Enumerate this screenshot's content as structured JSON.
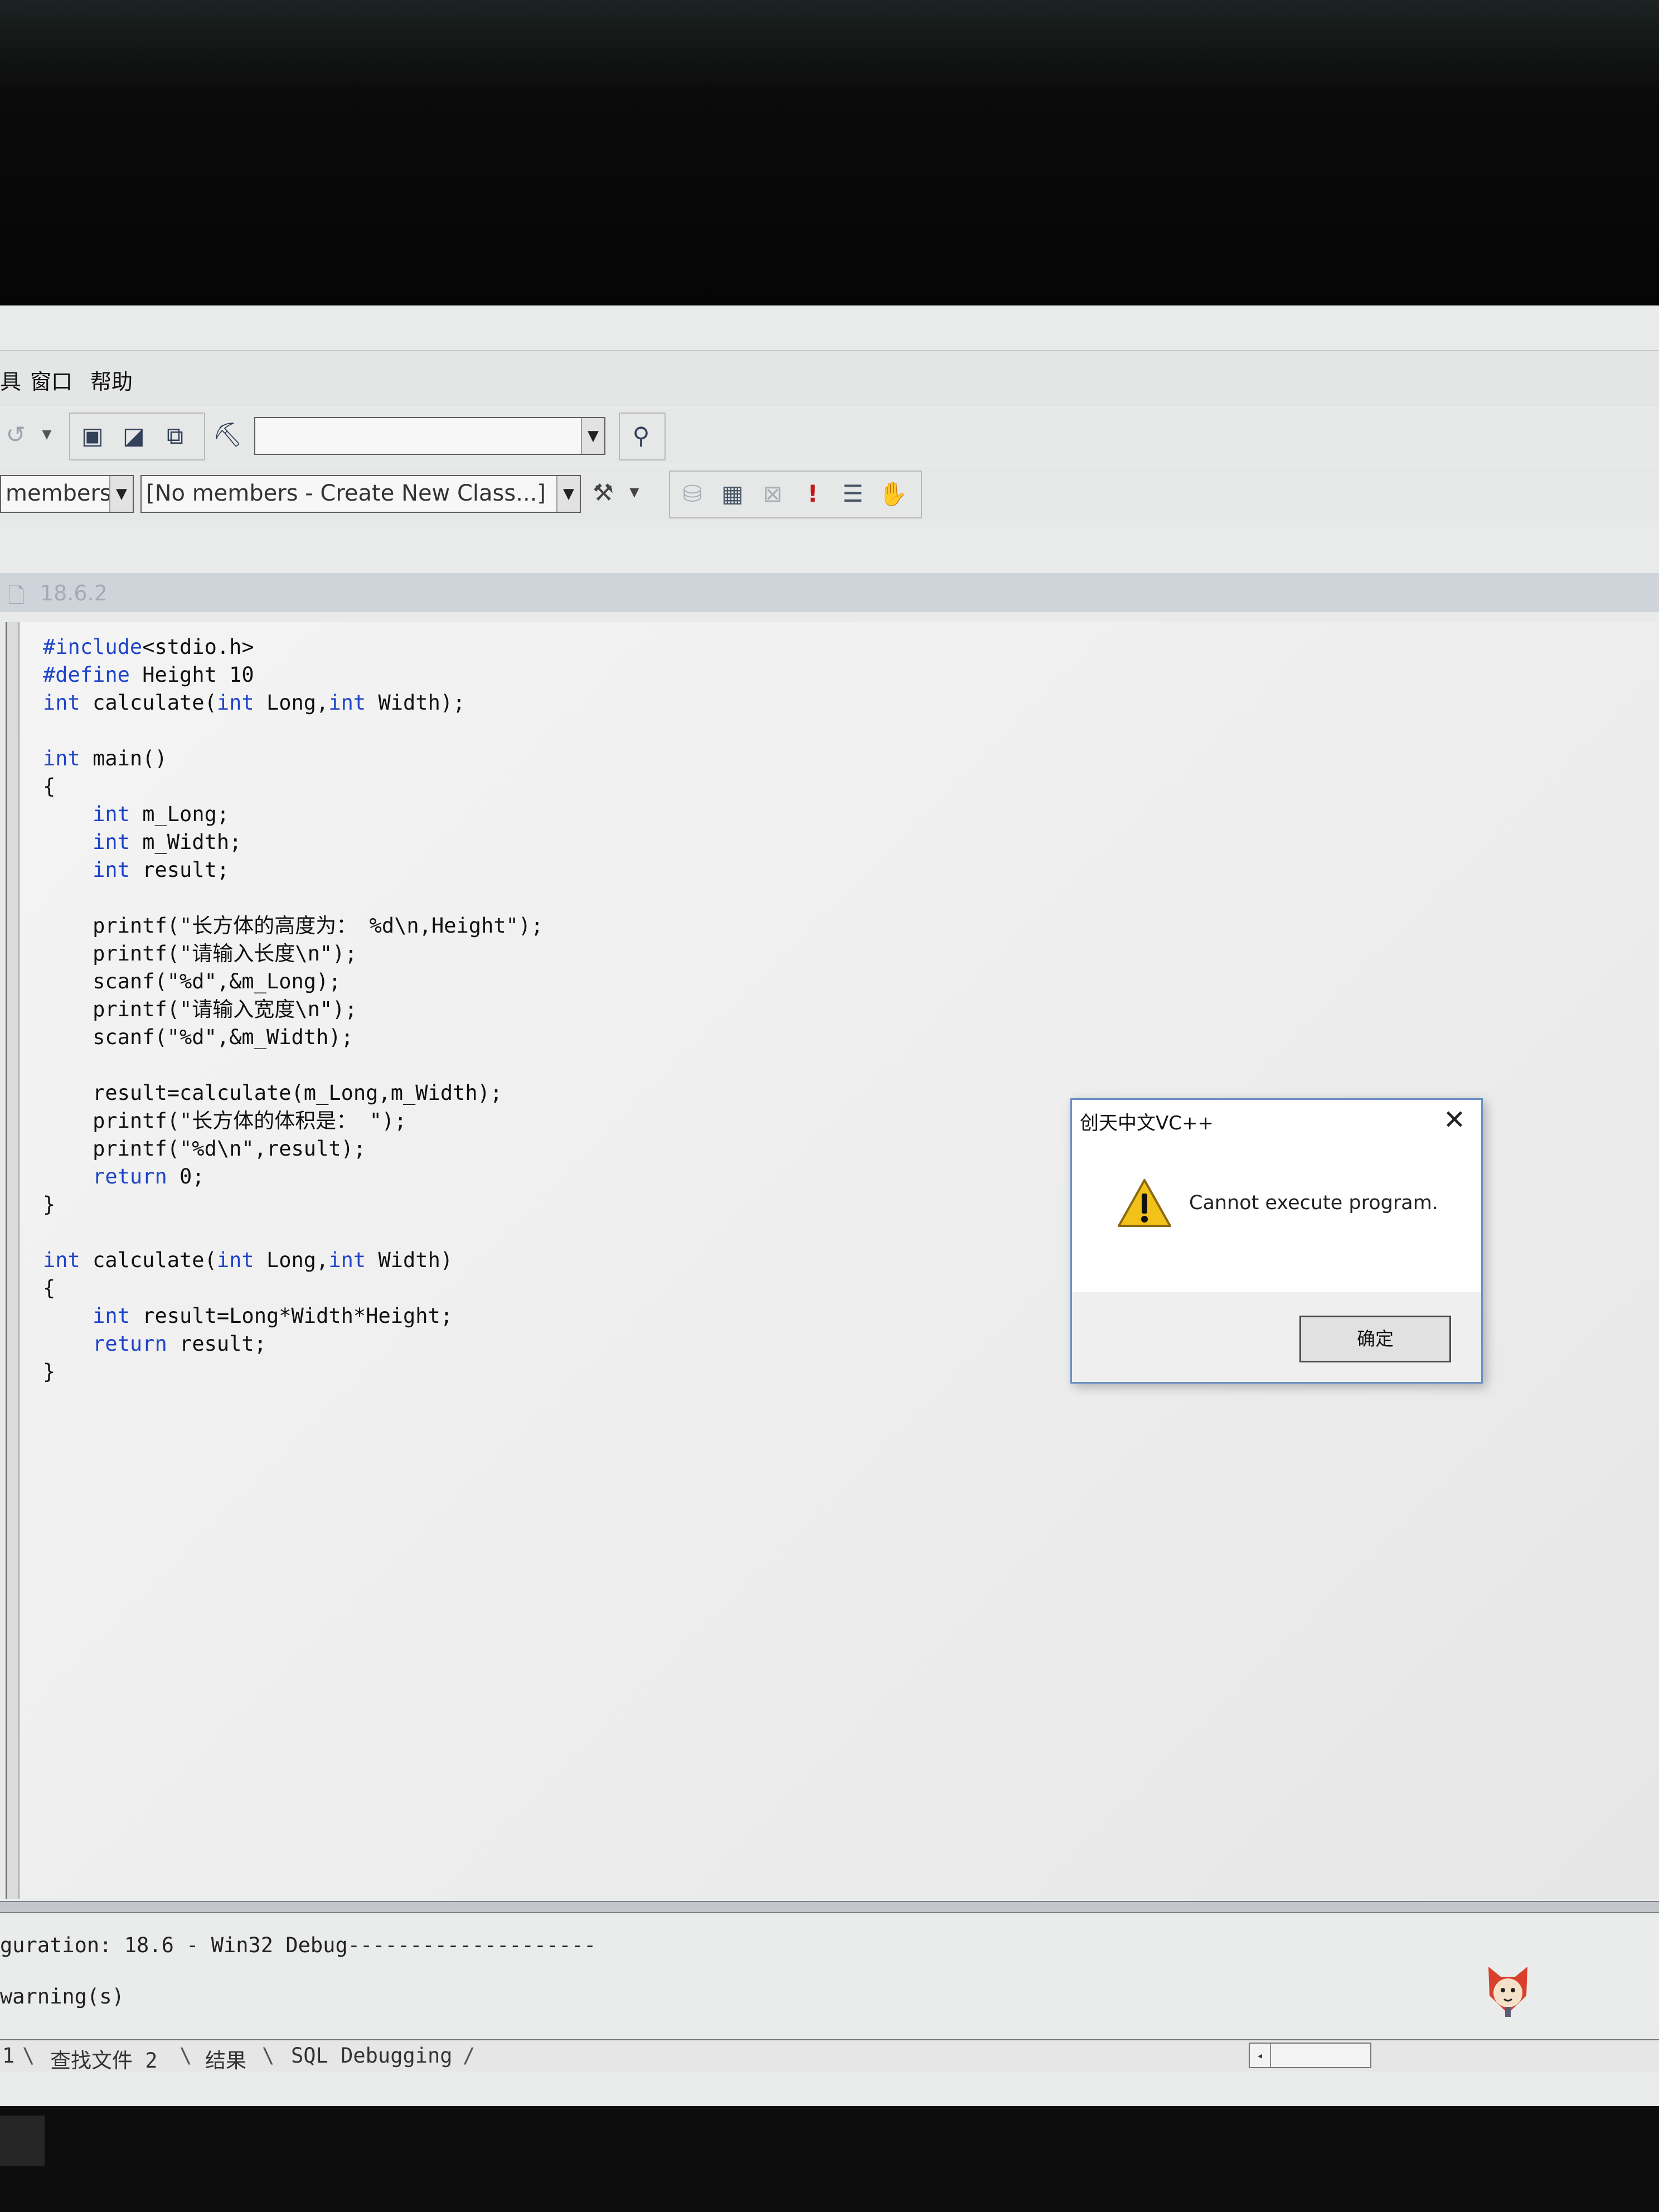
{
  "menubar": {
    "items": [
      "具",
      "窗口",
      "帮助"
    ]
  },
  "toolbar": {
    "combo_empty": "",
    "members_combo": "members",
    "class_combo": "[No members - Create New Class...]"
  },
  "editor": {
    "tab_title": "18.6.2",
    "code_lines": [
      [
        {
          "t": "#include",
          "c": "pp"
        },
        {
          "t": "<stdio.h>"
        }
      ],
      [
        {
          "t": "#define",
          "c": "pp"
        },
        {
          "t": " Height 10"
        }
      ],
      [
        {
          "t": "int",
          "c": "kw"
        },
        {
          "t": " calculate("
        },
        {
          "t": "int",
          "c": "kw"
        },
        {
          "t": " Long,"
        },
        {
          "t": "int",
          "c": "kw"
        },
        {
          "t": " Width);"
        }
      ],
      [],
      [
        {
          "t": "int",
          "c": "kw"
        },
        {
          "t": " main()"
        }
      ],
      [
        {
          "t": "{"
        }
      ],
      [
        {
          "t": "    "
        },
        {
          "t": "int",
          "c": "kw"
        },
        {
          "t": " m_Long;"
        }
      ],
      [
        {
          "t": "    "
        },
        {
          "t": "int",
          "c": "kw"
        },
        {
          "t": " m_Width;"
        }
      ],
      [
        {
          "t": "    "
        },
        {
          "t": "int",
          "c": "kw"
        },
        {
          "t": " result;"
        }
      ],
      [],
      [
        {
          "t": "    printf(\"长方体的高度为： %d\\n,Height\");"
        }
      ],
      [
        {
          "t": "    printf(\"请输入长度\\n\");"
        }
      ],
      [
        {
          "t": "    scanf(\"%d\",&m_Long);"
        }
      ],
      [
        {
          "t": "    printf(\"请输入宽度\\n\");"
        }
      ],
      [
        {
          "t": "    scanf(\"%d\",&m_Width);"
        }
      ],
      [],
      [
        {
          "t": "    result=calculate(m_Long,m_Width);"
        }
      ],
      [
        {
          "t": "    printf(\"长方体的体积是： \");"
        }
      ],
      [
        {
          "t": "    printf(\"%d\\n\",result);"
        }
      ],
      [
        {
          "t": "    "
        },
        {
          "t": "return",
          "c": "kw"
        },
        {
          "t": " 0;"
        }
      ],
      [
        {
          "t": "}"
        }
      ],
      [],
      [
        {
          "t": "int",
          "c": "kw"
        },
        {
          "t": " calculate("
        },
        {
          "t": "int",
          "c": "kw"
        },
        {
          "t": " Long,"
        },
        {
          "t": "int",
          "c": "kw"
        },
        {
          "t": " Width)"
        }
      ],
      [
        {
          "t": "{"
        }
      ],
      [
        {
          "t": "    "
        },
        {
          "t": "int",
          "c": "kw"
        },
        {
          "t": " result=Long*Width*Height;"
        }
      ],
      [
        {
          "t": "    "
        },
        {
          "t": "return",
          "c": "kw"
        },
        {
          "t": " result;"
        }
      ],
      [
        {
          "t": "}"
        }
      ]
    ]
  },
  "output": {
    "line_config": "guration: 18.6 - Win32 Debug--------------------",
    "line_warnings": "warning(s)"
  },
  "tabs": {
    "items": [
      "1",
      "查找文件 2",
      "结果",
      "SQL Debugging"
    ]
  },
  "dialog": {
    "title": "创天中文VC++",
    "close_glyph": "✕",
    "message": "Cannot execute program.",
    "ok_label": "确定"
  },
  "colors": {
    "keyword": "#1e44c8",
    "dialog_border": "#6b8fc4",
    "warning_yellow": "#f2c21b"
  },
  "icons": [
    "undo-icon",
    "workspace-icon",
    "output-icon",
    "windows-icon",
    "find-in-files-icon",
    "binoculars-icon",
    "wizard-icon",
    "compile-icon",
    "build-icon",
    "stop-build-icon",
    "execute-icon",
    "go-icon",
    "breakpoint-icon",
    "warning-icon"
  ]
}
